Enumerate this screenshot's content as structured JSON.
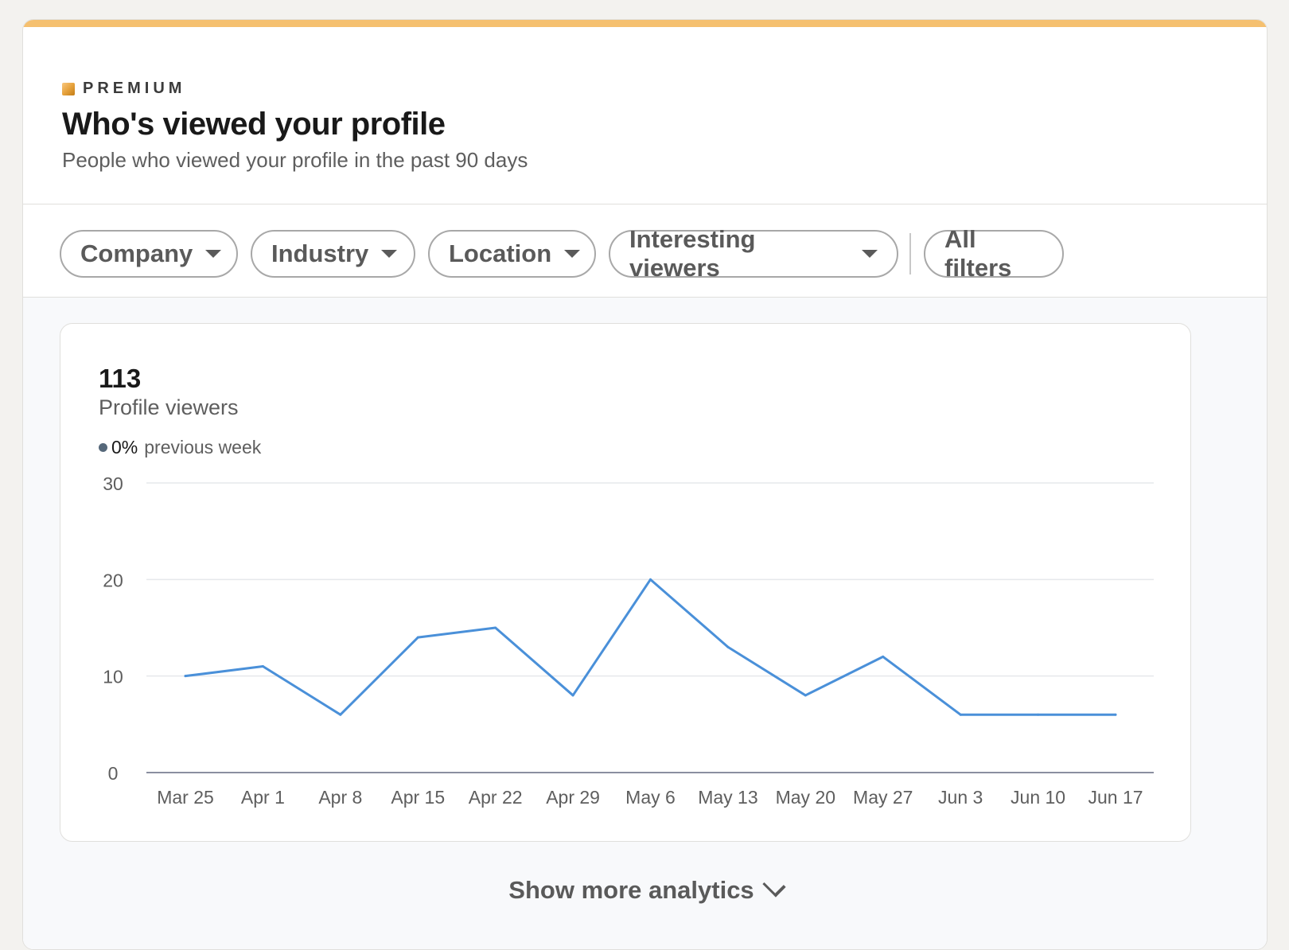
{
  "header": {
    "premium_label": "PREMIUM",
    "title": "Who's viewed your profile",
    "subtitle": "People who viewed your profile in the past 90 days",
    "accent_color": "#f5c06f"
  },
  "filters": [
    {
      "label": "Company",
      "has_dropdown": true
    },
    {
      "label": "Industry",
      "has_dropdown": true
    },
    {
      "label": "Location",
      "has_dropdown": true
    },
    {
      "label": "Interesting viewers",
      "has_dropdown": true
    },
    {
      "label": "All filters",
      "has_dropdown": false
    }
  ],
  "summary": {
    "count": "113",
    "label": "Profile viewers",
    "change_value": "0%",
    "change_text": "previous week"
  },
  "chart_data": {
    "type": "line",
    "categories": [
      "Mar 25",
      "Apr 1",
      "Apr 8",
      "Apr 15",
      "Apr 22",
      "Apr 29",
      "May 6",
      "May 13",
      "May 20",
      "May 27",
      "Jun 3",
      "Jun 10",
      "Jun 17"
    ],
    "values": [
      10,
      11,
      6,
      14,
      15,
      8,
      20,
      13,
      8,
      12,
      6,
      6,
      6
    ],
    "ylim": [
      0,
      30
    ],
    "yticks": [
      0,
      10,
      20,
      30
    ],
    "grid": true,
    "line_color": "#4a90d9"
  },
  "footer": {
    "show_more_label": "Show more analytics"
  }
}
